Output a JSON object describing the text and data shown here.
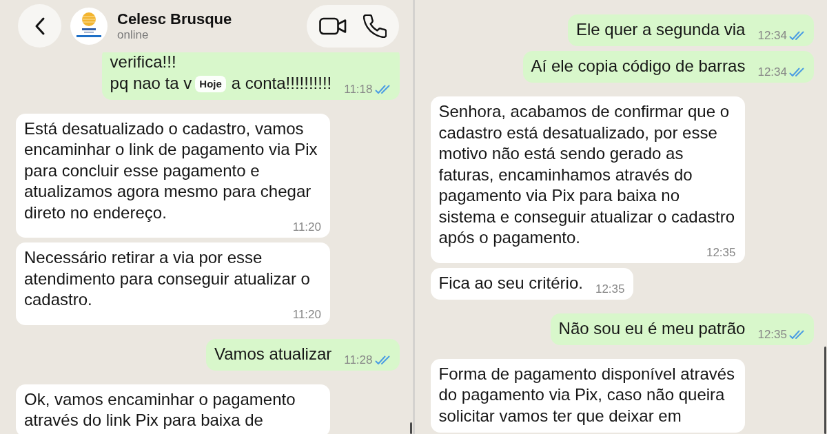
{
  "panels": [
    {
      "header": {
        "title": "Celesc Brusque",
        "status": "online"
      },
      "messages": [
        {
          "kind": "outgoing",
          "text": "verifica!!!\npq nao ta v",
          "date_chip": "Hoje",
          "text_after": "a conta!!!!!!!!!!",
          "time": "11:18",
          "read": true
        },
        {
          "kind": "incoming",
          "text": "Está desatualizado o cadastro, vamos encaminhar o link de pagamento via Pix para concluir esse pagamento e atualizamos agora mesmo para chegar direto no endereço.",
          "time": "11:20"
        },
        {
          "kind": "incoming",
          "text": "Necessário retirar a via por esse atendimento para conseguir atualizar o cadastro.",
          "time": "11:20"
        },
        {
          "kind": "outgoing",
          "text": "Vamos atualizar",
          "time": "11:28",
          "read": true
        },
        {
          "kind": "incoming",
          "text": "Ok, vamos encaminhar o pagamento através do link Pix para baixa de"
        }
      ]
    },
    {
      "messages": [
        {
          "kind": "outgoing",
          "text": "Ele quer a segunda via",
          "time": "12:34",
          "read": true
        },
        {
          "kind": "outgoing",
          "text": "Aí ele copia código de barras",
          "time": "12:34",
          "read": true
        },
        {
          "kind": "incoming",
          "text": "Senhora, acabamos de confirmar que o cadastro está desatualizado, por esse motivo não está sendo gerado as faturas, encaminhamos através do pagamento via Pix para baixa no sistema e conseguir atualizar o cadastro após o pagamento.",
          "time": "12:35"
        },
        {
          "kind": "incoming",
          "text": "Fica ao seu critério.",
          "time": "12:35"
        },
        {
          "kind": "outgoing",
          "text": "Não sou eu é meu patrão",
          "time": "12:35",
          "read": true
        },
        {
          "kind": "incoming",
          "text": "Forma de pagamento disponível através do pagamento via Pix, caso não queira solicitar vamos ter que deixar em"
        }
      ]
    }
  ]
}
